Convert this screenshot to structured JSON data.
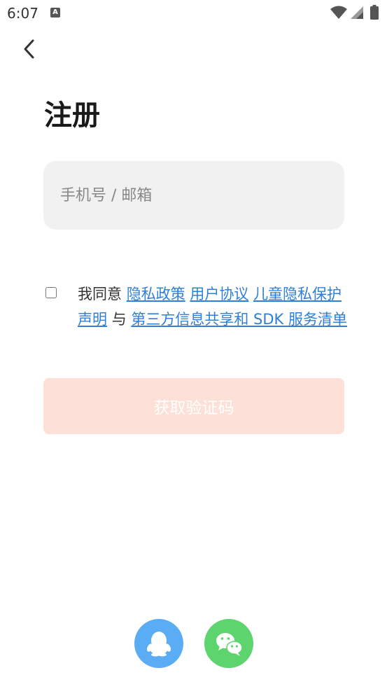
{
  "status_bar": {
    "time": "6:07",
    "notification_icon": "A"
  },
  "header": {
    "title": "注册"
  },
  "form": {
    "account_placeholder": "手机号 / 邮箱"
  },
  "agreement": {
    "prefix": "我同意",
    "privacy_policy": "隐私政策",
    "user_agreement": "用户协议",
    "child_privacy": "儿童隐私保护声明",
    "conjunction": "与",
    "third_party": "第三方信息共享和 SDK 服务清单"
  },
  "actions": {
    "get_code_label": "获取验证码"
  },
  "colors": {
    "link": "#2f7fd8",
    "button_disabled_bg": "#fde0d7",
    "qq": "#5aacf4",
    "wechat": "#5ed46e"
  },
  "icons": {
    "back": "chevron-left-icon",
    "qq": "qq-penguin-icon",
    "wechat": "wechat-chat-icon"
  }
}
